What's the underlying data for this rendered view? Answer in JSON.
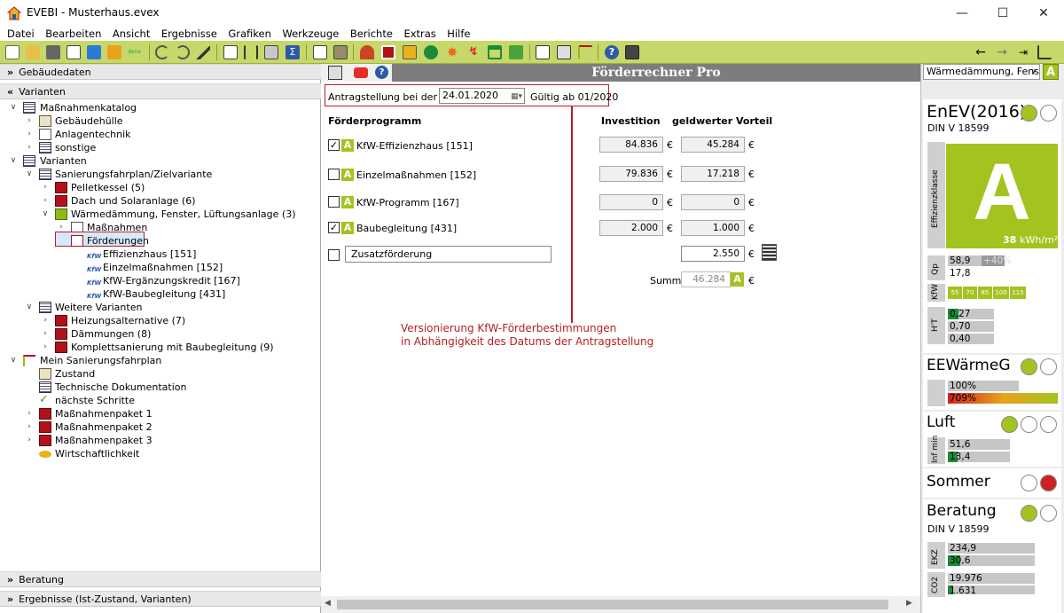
{
  "window": {
    "title": "EVEBI - Musterhaus.evex"
  },
  "menu": [
    "Datei",
    "Bearbeiten",
    "Ansicht",
    "Ergebnisse",
    "Grafiken",
    "Werkzeuge",
    "Berichte",
    "Extras",
    "Hilfe"
  ],
  "left": {
    "sections": {
      "gebaeudedaten": "Gebäudedaten",
      "varianten": "Varianten",
      "beratung": "Beratung",
      "ergebnisse": "Ergebnisse (Ist-Zustand, Varianten)"
    },
    "tree": [
      "Maßnahmenkatalog",
      "Gebäudehülle",
      "Anlagentechnik",
      "sonstige",
      "Varianten",
      "Sanierungsfahrplan/Zielvariante",
      "Pelletkessel (5)",
      "Dach und Solaranlage (6)",
      "Wärmedämmung, Fenster, Lüftungsanlage (3)",
      "Maßnahmen",
      "Förderungen",
      "Effizienzhaus [151]",
      "Einzelmaßnahmen [152]",
      "KfW-Ergänzungskredit [167]",
      "KfW-Baubegleitung [431]",
      "Weitere Varianten",
      "Heizungsalternative (7)",
      "Dämmungen (8)",
      "Komplettsanierung mit Baubegleitung (9)",
      "Mein Sanierungsfahrplan",
      "Zustand",
      "Technische Dokumentation",
      "nächste Schritte",
      "Maßnahmenpaket 1",
      "Maßnahmenpaket 2",
      "Maßnahmenpaket 3",
      "Wirtschaftlichkeit"
    ],
    "kfw_tag": "KfW"
  },
  "center": {
    "title": "Förderrechner Pro",
    "antrag_label": "Antragstellung bei der KfW",
    "antrag_date": "24.01.2020",
    "gueltig": "Gültig ab 01/2020",
    "col_program": "Förderprogramm",
    "col_invest": "Investition",
    "col_vorteil": "geldwerter Vorteil",
    "rows": [
      {
        "name": "KfW-Effizienzhaus [151]",
        "checked": "✓",
        "invest": "84.836",
        "vorteil": "45.284"
      },
      {
        "name": "Einzelmaßnahmen [152]",
        "checked": "",
        "invest": "79.836",
        "vorteil": "17.218"
      },
      {
        "name": "KfW-Programm [167]",
        "checked": "",
        "invest": "0",
        "vorteil": "0"
      },
      {
        "name": "Baubegleitung [431]",
        "checked": "✓",
        "invest": "2.000",
        "vorteil": "1.000"
      }
    ],
    "zusatz": {
      "label": "Zusatzförderung",
      "vorteil": "2.550"
    },
    "summe_label": "Summe",
    "summe": "46.284",
    "euro": "€",
    "badge": "A",
    "annotation_line1": "Versionierung KfW-Förderbestimmungen",
    "annotation_line2": "in Abhängigkeit des Datums der Antragstellung"
  },
  "right": {
    "dropdown": "Wärmedämmung, Fenste",
    "enev": {
      "title": "EnEV(2016)",
      "sub": "DIN V 18599",
      "klasse_label": "Effizienzklasse",
      "klasse": "A",
      "value": "38",
      "unit": "kWh/m²",
      "qp_label": "Qp",
      "qp1": "58,9",
      "qp_pct": "+40%",
      "qp2": "17,8",
      "kfw_label": "KfW",
      "kfw_levels": [
        "55",
        "70",
        "85",
        "100",
        "115"
      ],
      "ht_label": "H'T",
      "ht": [
        "0,27",
        "0,70",
        "0,40"
      ]
    },
    "ee": {
      "title": "EEWärmeG",
      "v1": "100%",
      "v2": "709%"
    },
    "luft": {
      "title": "Luft",
      "label": "Inf min",
      "v1": "51,6",
      "v2": "13,4"
    },
    "sommer": {
      "title": "Sommer"
    },
    "beratung": {
      "title": "Beratung",
      "sub": "DIN V 18599",
      "ekz_label": "EKZ",
      "ekz1": "234,9",
      "ekz2": "30,6",
      "co2_label": "CO2",
      "co1": "19.976",
      "co2": "1.631"
    },
    "colors": {
      "green": "#a3c31f",
      "red": "#cc2222"
    }
  }
}
